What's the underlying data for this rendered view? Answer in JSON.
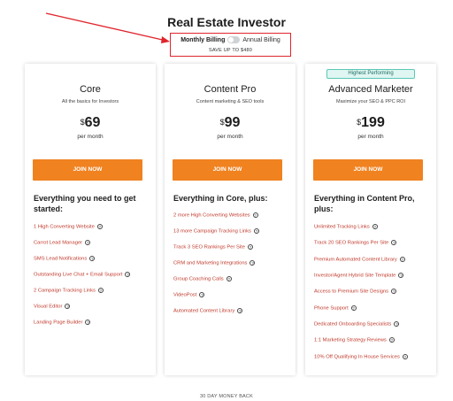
{
  "page": {
    "title": "Real Estate Investor",
    "footer_note": "30 DAY MONEY BACK"
  },
  "billing": {
    "monthly_label": "Monthly Billing",
    "annual_label": "Annual Billing",
    "save_text": "SAVE UP TO $480"
  },
  "colors": {
    "accent": "#f08220",
    "highlight_box": "#e0242b",
    "link": "#c0392b"
  },
  "plans": [
    {
      "name": "Core",
      "description": "All the basics for Investors",
      "currency": "$",
      "price": "69",
      "period": "per month",
      "button": "JOIN NOW",
      "features_title": "Everything you need to get started:",
      "features": [
        "1 High Converting Website",
        "Carrot Lead Manager",
        "SMS Lead Notifications",
        "Outstanding Live Chat + Email Support",
        "2 Campaign Tracking Links",
        "Visual Editor",
        "Landing Page Builder"
      ]
    },
    {
      "name": "Content Pro",
      "description": "Content marketing & SEO tools",
      "currency": "$",
      "price": "99",
      "period": "per month",
      "button": "JOIN NOW",
      "features_title": "Everything in Core, plus:",
      "features": [
        "2 more High Converting Websites",
        "13 more Campaign Tracking Links",
        "Track 3 SEO Rankings Per Site",
        "CRM and Marketing Integrations",
        "Group Coaching Calls",
        "VideoPost",
        "Automated Content Library"
      ]
    },
    {
      "badge": "Highest Performing",
      "name": "Advanced Marketer",
      "description": "Maximize your SEO & PPC ROI",
      "currency": "$",
      "price": "199",
      "period": "per month",
      "button": "JOIN NOW",
      "features_title": "Everything in Content Pro, plus:",
      "features": [
        "Unlimited Tracking Links",
        "Track 20 SEO Rankings Per Site",
        "Premium Automated Content Library",
        "Investor/Agent Hybrid Site Template",
        "Access to Premium Site Designs",
        "Phone Support",
        "Dedicated Onboarding Specialists",
        "1:1 Marketing Strategy Reviews",
        "10% Off Qualifying In House Services"
      ]
    }
  ]
}
